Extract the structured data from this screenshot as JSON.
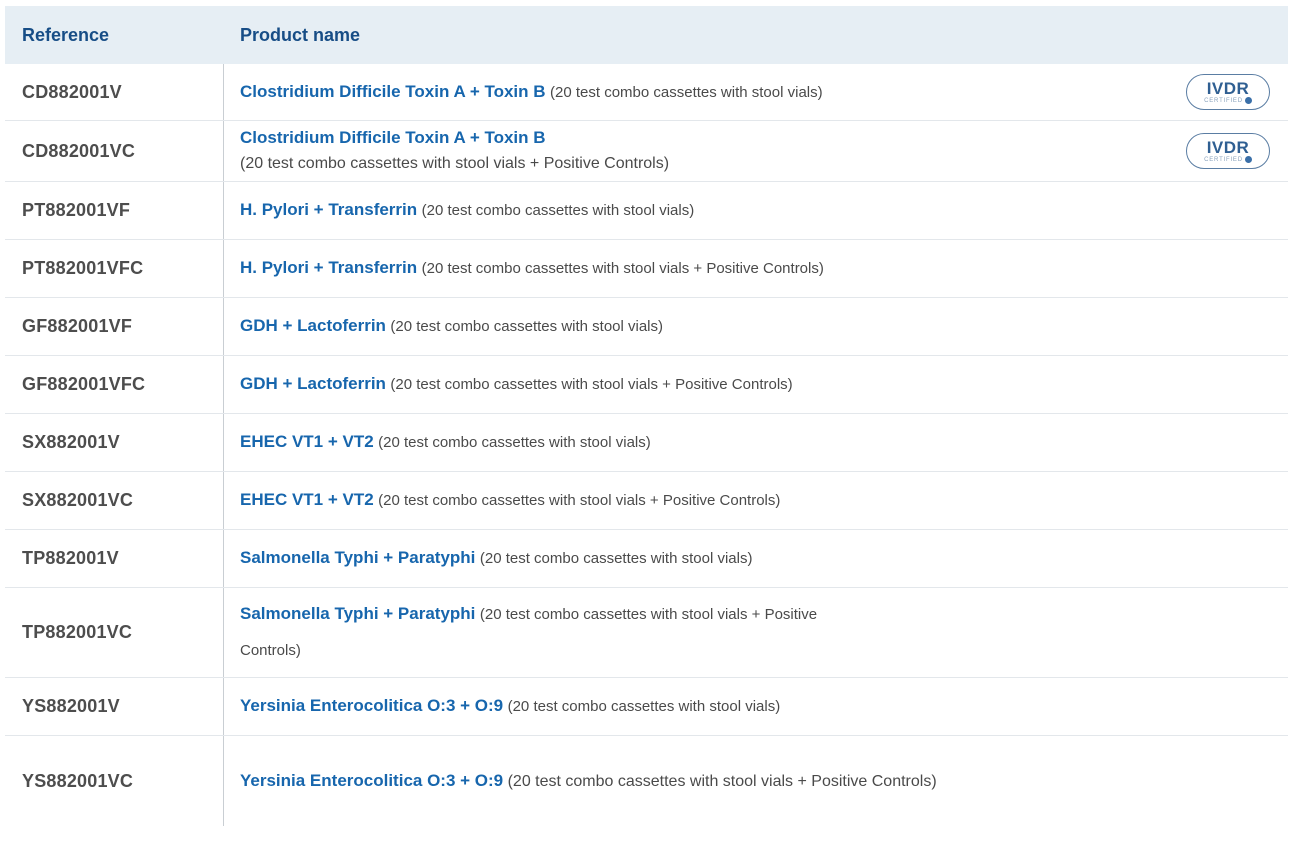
{
  "table": {
    "headers": {
      "reference": "Reference",
      "product": "Product name"
    },
    "badge": {
      "main": "IVDR",
      "sub": "CERTIFIED"
    },
    "rows": [
      {
        "ref": "CD882001V",
        "name": "Clostridium Difficile Toxin A + Toxin B",
        "desc": "(20 test combo cassettes with stool vials)",
        "badge": true
      },
      {
        "ref": "CD882001VC",
        "name": "Clostridium Difficile Toxin A + Toxin B",
        "desc": "(20 test combo cassettes with stool vials + Positive Controls)",
        "badge": true
      },
      {
        "ref": "PT882001VF",
        "name": "H. Pylori + Transferrin",
        "desc": "(20 test combo cassettes with stool vials)"
      },
      {
        "ref": "PT882001VFC",
        "name": "H. Pylori + Transferrin",
        "desc": "(20 test combo cassettes with stool vials + Positive Controls)"
      },
      {
        "ref": "GF882001VF",
        "name": "GDH + Lactoferrin",
        "desc": "(20 test combo cassettes with stool vials)"
      },
      {
        "ref": "GF882001VFC",
        "name": "GDH + Lactoferrin",
        "desc": "(20 test combo cassettes with stool vials + Positive Controls)"
      },
      {
        "ref": "SX882001V",
        "name": "EHEC VT1 + VT2",
        "desc": "(20 test combo cassettes with stool vials)"
      },
      {
        "ref": "SX882001VC",
        "name": "EHEC VT1 + VT2",
        "desc": "(20 test combo cassettes with stool vials + Positive Controls)"
      },
      {
        "ref": "TP882001V",
        "name": "Salmonella Typhi + Paratyphi",
        "desc": "(20 test combo cassettes with stool vials)"
      },
      {
        "ref": "TP882001VC",
        "name": "Salmonella Typhi + Paratyphi",
        "desc": "(20 test combo cassettes with stool vials + Positive",
        "desc2": "Controls)"
      },
      {
        "ref": "YS882001V",
        "name": "Yersinia Enterocolitica O:3 + O:9",
        "desc": "(20 test combo cassettes with stool vials)"
      },
      {
        "ref": "YS882001VC",
        "name": "Yersinia Enterocolitica O:3 + O:9",
        "desc": "(20 test combo cassettes with stool vials + Positive Controls)"
      }
    ]
  }
}
